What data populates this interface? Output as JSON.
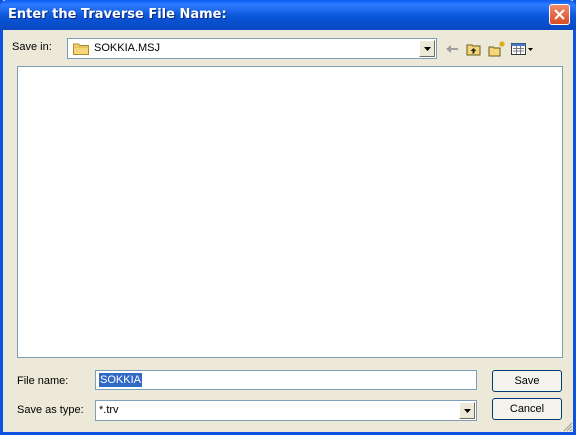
{
  "window": {
    "title": "Enter the Traverse File Name:"
  },
  "toolbar": {
    "save_in_label": "Save in:",
    "save_in_value": "SOKKIA.MSJ",
    "icons": [
      "folder-icon",
      "back-arrow-icon",
      "up-folder-icon",
      "new-folder-icon",
      "views-menu-icon"
    ]
  },
  "file_list": {
    "items": []
  },
  "form": {
    "file_name_label": "File name:",
    "file_name_value": "SOKKIA",
    "save_as_type_label": "Save as type:",
    "save_as_type_value": "*.trv"
  },
  "buttons": {
    "save": "Save",
    "cancel": "Cancel"
  },
  "colors": {
    "titlebar": "#0a55d8",
    "dialog_bg": "#ece9d8",
    "selection": "#316ac5",
    "close_button": "#d94c24"
  }
}
